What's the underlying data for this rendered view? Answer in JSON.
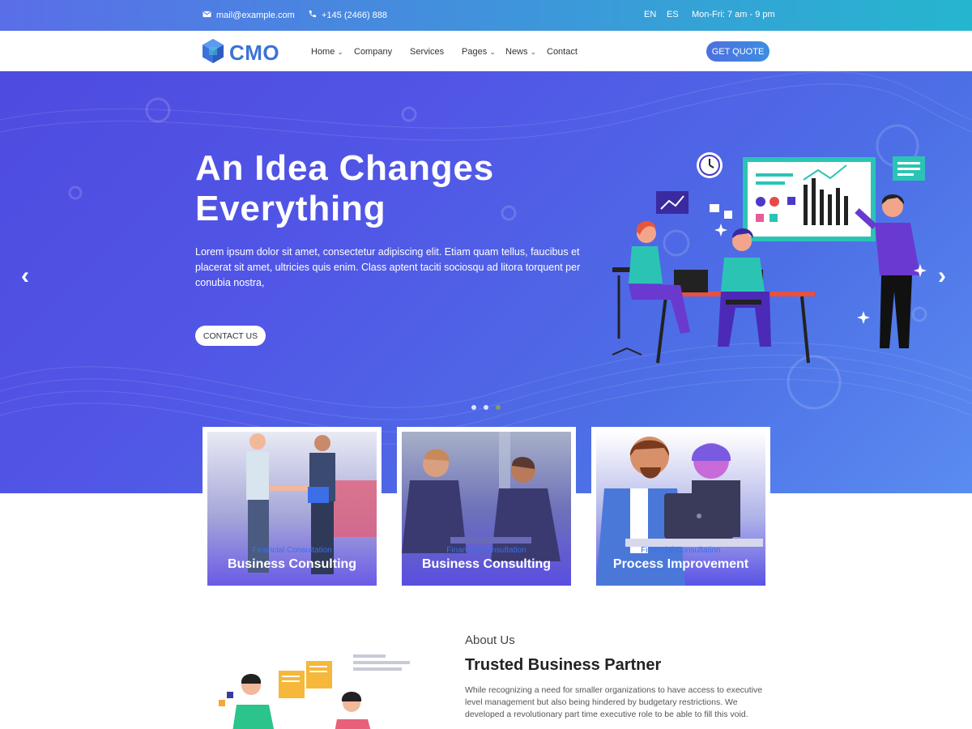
{
  "topbar": {
    "email": "mail@example.com",
    "phone": "+145 (2466) 888",
    "lang_en": "EN",
    "lang_es": "ES",
    "hours": "Mon-Fri: 7 am - 9 pm"
  },
  "nav": {
    "logo": "CMO",
    "items": [
      "Home",
      "Company",
      "Services",
      "Pages",
      "News",
      "Contact"
    ],
    "quote_button": "GET QUOTE"
  },
  "hero": {
    "title_line1": "An Idea Changes",
    "title_line2": "Everything",
    "text": "Lorem ipsum dolor sit amet, consectetur adipiscing elit. Etiam quam tellus, faucibus et placerat sit amet, ultricies quis enim. Class aptent taciti sociosqu ad litora torquent per conubia nostra,",
    "button": "CONTACT US",
    "slide_count": 3,
    "active_slide": 3
  },
  "cards": [
    {
      "subtitle": "Financial Consultation",
      "title": "Business Consulting"
    },
    {
      "subtitle": "Financial Consultation",
      "title": "Business Consulting"
    },
    {
      "subtitle": "Financial Consultation",
      "title": "Process Improvement"
    }
  ],
  "about": {
    "label": "About Us",
    "title": "Trusted Business Partner",
    "text": "While recognizing a need for smaller organizations to have access to executive level management but also being hindered by budgetary restrictions. We developed a revolutionary part time executive role to be able to fill this void."
  },
  "colors": {
    "accent": "#3c73d8",
    "hero_start": "#4e4be0",
    "hero_end": "#5a8cf0",
    "topbar_end": "#25b6cf"
  }
}
